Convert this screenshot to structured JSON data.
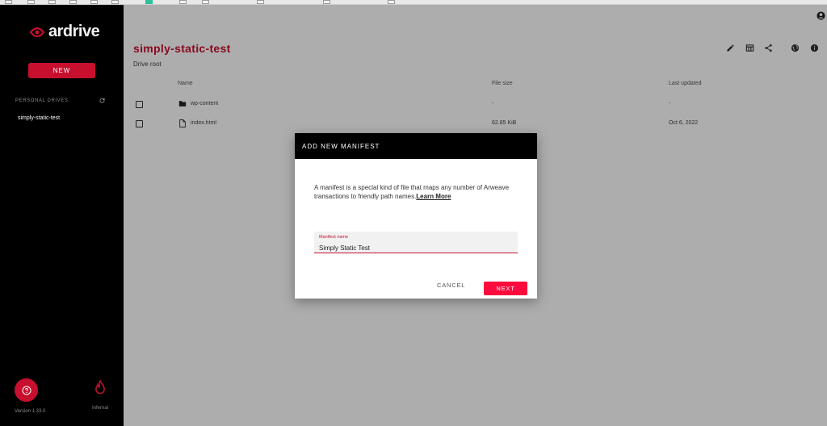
{
  "sidebar": {
    "logo_text": "ardrive",
    "new_button": "NEW",
    "drives_section_title": "PERSONAL DRIVES",
    "drives": [
      {
        "label": "simply-static-test"
      }
    ],
    "version": "Version 1.33.0",
    "infernal_label": "Infernal"
  },
  "header": {
    "drive_title": "simply-static-test",
    "breadcrumb": "Drive root",
    "actions": [
      "edit-icon",
      "table-view-icon",
      "share-icon",
      "globe-icon",
      "info-icon"
    ]
  },
  "table": {
    "columns": [
      "Name",
      "File size",
      "Last updated"
    ],
    "rows": [
      {
        "icon": "folder-icon",
        "name": "wp-content",
        "size": "-",
        "updated": "-"
      },
      {
        "icon": "file-icon",
        "name": "index.html",
        "size": "62.85 KiB",
        "updated": "Oct 6, 2022"
      }
    ]
  },
  "dialog": {
    "title": "ADD NEW MANIFEST",
    "body": "A manifest is a special kind of file that maps any number of Arweave transactions to friendly path names.",
    "learn_more": "Learn More",
    "field_label": "Manifest name",
    "field_value": "Simply Static Test",
    "cancel": "CANCEL",
    "next": "NEXT"
  },
  "colors": {
    "brand_red": "#c8102e",
    "next_button": "#ff0a3c",
    "sidebar_bg": "#000000"
  }
}
